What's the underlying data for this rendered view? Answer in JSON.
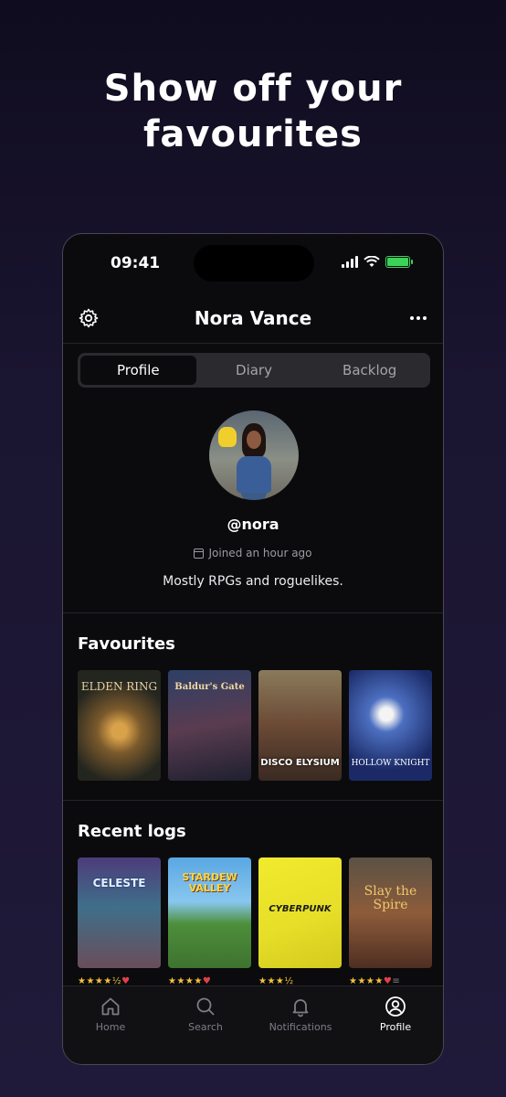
{
  "headline": {
    "line1": "Show off your",
    "line2": "favourites"
  },
  "status_bar": {
    "time": "09:41"
  },
  "header": {
    "title": "Nora Vance"
  },
  "tabs": [
    {
      "label": "Profile",
      "active": true
    },
    {
      "label": "Diary",
      "active": false
    },
    {
      "label": "Backlog",
      "active": false
    }
  ],
  "profile": {
    "handle": "@nora",
    "joined": "Joined an hour ago",
    "bio": "Mostly RPGs and roguelikes."
  },
  "favourites": {
    "title": "Favourites",
    "games": [
      {
        "cover_text": "ELDEN RING"
      },
      {
        "cover_text": "Baldur's Gate"
      },
      {
        "cover_text": "DISCO ELYSIUM"
      },
      {
        "cover_text": "HOLLOW KNIGHT"
      }
    ]
  },
  "recent_logs": {
    "title": "Recent logs",
    "games": [
      {
        "cover_text": "CELESTE",
        "rating": "★★★★½",
        "liked": true
      },
      {
        "cover_text": "STARDEW VALLEY",
        "rating": "★★★★",
        "liked": true
      },
      {
        "cover_text": "CYBERPUNK",
        "rating": "★★★½",
        "liked": false
      },
      {
        "cover_text": "Slay the Spire",
        "rating": "★★★★",
        "liked": true
      }
    ]
  },
  "tabbar": [
    {
      "label": "Home",
      "icon": "home-icon",
      "active": false
    },
    {
      "label": "Search",
      "icon": "search-icon",
      "active": false
    },
    {
      "label": "Notifications",
      "icon": "bell-icon",
      "active": false
    },
    {
      "label": "Profile",
      "icon": "profile-icon",
      "active": true
    }
  ],
  "colors": {
    "accent": "#f3c13a",
    "heart": "#e5404a",
    "battery": "#3bd25a"
  }
}
